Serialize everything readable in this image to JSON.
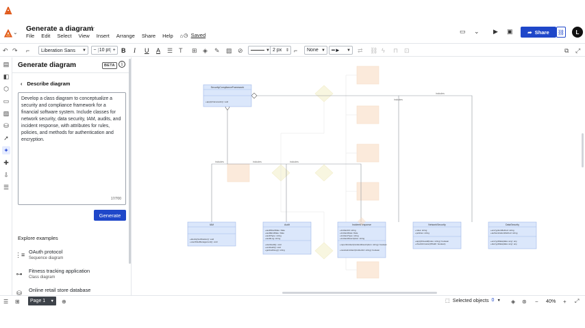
{
  "header": {
    "doc_title": "Generate a diagram",
    "menu": [
      "File",
      "Edit",
      "Select",
      "View",
      "Insert",
      "Arrange",
      "Share",
      "Help"
    ],
    "saved_label": "Saved",
    "share_label": "Share",
    "avatar_initial": "L"
  },
  "toolbar": {
    "font_family": "Liberation Sans",
    "font_size": "10 pt",
    "minus": "−",
    "plus": "+",
    "line_width": "2 px",
    "line_start": "None"
  },
  "panel": {
    "title": "Generate diagram",
    "badge": "BETA",
    "back_label": "Describe diagram",
    "prompt_text": "Develop a class diagram to conceptualize a security and compliance framework for a financial software system. Include classes for network security, data security, IAM, audits, and incident response, with attributes for rules, policies, and methods for authentication and encryption.",
    "char_counter": "17/700",
    "generate_label": "Generate",
    "explore_title": "Explore examples",
    "examples": [
      {
        "title": "OAuth protocol",
        "subtitle": "Sequence diagram",
        "icon": "sequence-icon"
      },
      {
        "title": "Fitness tracking application",
        "subtitle": "Class diagram",
        "icon": "class-icon"
      },
      {
        "title": "Online retail store database",
        "subtitle": "",
        "icon": "database-icon"
      }
    ]
  },
  "canvas": {
    "top_class": {
      "title": "SecurityComplianceFramework",
      "attrs": [],
      "methods": [
        "+applyFramework(): void"
      ]
    },
    "bottom_classes": [
      {
        "title": "IAM",
        "attrs": [],
        "methods": [
          "+identityVerification(): void",
          "+userRoleManagement(): void"
        ]
      },
      {
        "title": "Audit",
        "attrs": [
          "+auditStartDate: Date",
          "+auditEndDate: Date",
          "+auditType: string",
          "+auditLog: string"
        ],
        "methods": [
          "+startAudit(): void",
          "+endAudit(): void",
          "+getAuditLog(): string"
        ]
      },
      {
        "title": "IncidentResponse",
        "attrs": [
          "+incidentId: string",
          "+incidentDate: Date",
          "+incidentType: string",
          "+incidentDescription: string"
        ],
        "methods": [
          "+reportIncident(incidentDescription: string): boolean",
          "+resolveIncident(incidentId: string): boolean"
        ]
      },
      {
        "title": "NetworkSecurity",
        "attrs": [
          "+rules: string",
          "+policies: string"
        ],
        "methods": [
          "+applyFirewall(rules: string): boolean",
          "+checkIntrusion(IPAddr: boolean)"
        ]
      },
      {
        "title": "DataSecurity",
        "attrs": [
          "+encryptionMethod: string",
          "+authenticationMethod: string"
        ],
        "methods": [
          "+encryptData(data: any): any",
          "+decryptData(data: any): any"
        ]
      }
    ],
    "edge_labels": [
      "includes",
      "includes",
      "includes",
      "includes",
      "includes"
    ]
  },
  "bottombar": {
    "page_label": "Page 1",
    "selected_objects_label": "Selected objects",
    "selected_count": "0",
    "zoom_level": "40%",
    "zoom_minus": "−",
    "zoom_plus": "+"
  },
  "colors": {
    "accent": "#1f47c9",
    "class_fill": "#dbe7fb",
    "class_stroke": "#9fb8ea",
    "ghost_fill": "#f8d9bf",
    "ghost_stroke": "#f1c59e",
    "ghost_diamond": "#f3efc8"
  }
}
